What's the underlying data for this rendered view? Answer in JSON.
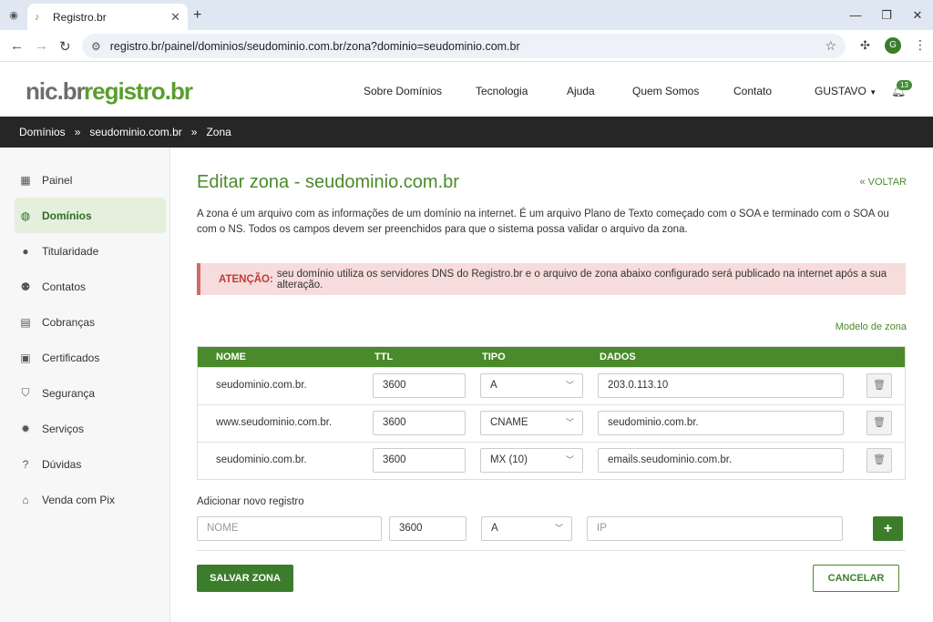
{
  "browser": {
    "tab_title": "Registro.br",
    "url": "registro.br/painel/dominios/seudominio.com.br/zona?dominio=seudominio.com.br",
    "profile_initial": "G"
  },
  "header": {
    "logo_nic": "nic.br",
    "logo_registro": "registro.br",
    "nav": [
      "Sobre Domínios",
      "Tecnologia",
      "Ajuda",
      "Quem Somos",
      "Contato"
    ],
    "user": "GUSTAVO",
    "notifications": "13"
  },
  "breadcrumb": [
    "Domínios",
    "seudominio.com.br",
    "Zona"
  ],
  "sidebar": {
    "items": [
      {
        "label": "Painel",
        "icon": "dashboard-icon",
        "glyph": "▦"
      },
      {
        "label": "Domínios",
        "icon": "globe-icon",
        "glyph": "◍"
      },
      {
        "label": "Titularidade",
        "icon": "person-icon",
        "glyph": "●"
      },
      {
        "label": "Contatos",
        "icon": "people-icon",
        "glyph": "⚉"
      },
      {
        "label": "Cobranças",
        "icon": "calendar-icon",
        "glyph": "▤"
      },
      {
        "label": "Certificados",
        "icon": "certificate-icon",
        "glyph": "▣"
      },
      {
        "label": "Segurança",
        "icon": "shield-icon",
        "glyph": "⛉"
      },
      {
        "label": "Serviços",
        "icon": "gear-icon",
        "glyph": "✹"
      },
      {
        "label": "Dúvidas",
        "icon": "help-icon",
        "glyph": "?"
      },
      {
        "label": "Venda com Pix",
        "icon": "store-icon",
        "glyph": "⌂"
      }
    ],
    "active_index": 1
  },
  "main": {
    "title": "Editar zona - seudominio.com.br",
    "back_link": "« VOLTAR",
    "intro": "A zona é um arquivo com as informações de um domínio na internet. É um arquivo Plano de Texto começado com o SOA e terminado com o SOA ou com o NS. Todos os campos devem ser preenchidos para que o sistema possa validar o arquivo da zona.",
    "alert_label": "ATENÇÃO:",
    "alert_text": "seu domínio utiliza os servidores DNS do Registro.br e o arquivo de zona abaixo configurado será publicado na internet após a sua alteração.",
    "model_link": "Modelo de zona",
    "table": {
      "headers": [
        "NOME",
        "TTL",
        "TIPO",
        "DADOS"
      ],
      "rows": [
        {
          "name": "seudominio.com.br.",
          "ttl": "3600",
          "type": "A",
          "data": "203.0.113.10"
        },
        {
          "name": "www.seudominio.com.br.",
          "ttl": "3600",
          "type": "CNAME",
          "data": "seudominio.com.br."
        },
        {
          "name": "seudominio.com.br.",
          "ttl": "3600",
          "type": "MX (10)",
          "data": "emails.seudominio.com.br."
        }
      ]
    },
    "add": {
      "label": "Adicionar novo registro",
      "name_placeholder": "NOME",
      "ttl": "3600",
      "type": "A",
      "data_placeholder": "IP"
    },
    "save_label": "SALVAR ZONA",
    "cancel_label": "CANCELAR"
  },
  "colors": {
    "brand_green": "#4a8a2a",
    "alert_bg": "#f7dcdc",
    "dark_bar": "#262626"
  }
}
